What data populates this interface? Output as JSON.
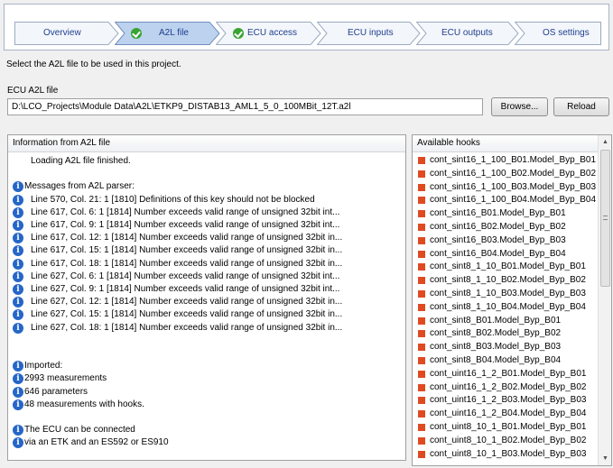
{
  "wizard": {
    "steps": [
      {
        "label": "Overview",
        "done": false,
        "active": false
      },
      {
        "label": "A2L file",
        "done": true,
        "active": true
      },
      {
        "label": "ECU access",
        "done": true,
        "active": false
      },
      {
        "label": "ECU inputs",
        "done": false,
        "active": false
      },
      {
        "label": "ECU outputs",
        "done": false,
        "active": false
      },
      {
        "label": "OS settings",
        "done": false,
        "active": false
      }
    ]
  },
  "hint": "Select the A2L file to be used  in this project.",
  "ecu_file": {
    "label": "ECU A2L file",
    "path": "D:\\LCO_Projects\\Module Data\\A2L\\ETKP9_DISTAB13_AML1_5_0_100MBit_12T.a2l",
    "browse_label": "Browse...",
    "reload_label": "Reload"
  },
  "info": {
    "header": "Information from A2L file",
    "lines": [
      {
        "text": "Loading A2L file finished.",
        "icon": false,
        "indent": true
      },
      {
        "text": "",
        "icon": false,
        "indent": false
      },
      {
        "text": "Messages from A2L parser:",
        "icon": true,
        "indent": false
      },
      {
        "text": "Line 570, Col. 21: 1 [1810] Definitions of this key should not be blocked",
        "icon": true,
        "indent": true
      },
      {
        "text": "Line 617, Col. 6: 1 [1814] Number exceeds valid range of unsigned 32bit int...",
        "icon": true,
        "indent": true
      },
      {
        "text": "Line 617, Col. 9: 1 [1814] Number exceeds valid range of unsigned 32bit int...",
        "icon": true,
        "indent": true
      },
      {
        "text": "Line 617, Col. 12: 1 [1814] Number exceeds valid range of unsigned 32bit in...",
        "icon": true,
        "indent": true
      },
      {
        "text": "Line 617, Col. 15: 1 [1814] Number exceeds valid range of unsigned 32bit in...",
        "icon": true,
        "indent": true
      },
      {
        "text": "Line 617, Col. 18: 1 [1814] Number exceeds valid range of unsigned 32bit in...",
        "icon": true,
        "indent": true
      },
      {
        "text": "Line 627, Col. 6: 1 [1814] Number exceeds valid range of unsigned 32bit int...",
        "icon": true,
        "indent": true
      },
      {
        "text": "Line 627, Col. 9: 1 [1814] Number exceeds valid range of unsigned 32bit int...",
        "icon": true,
        "indent": true
      },
      {
        "text": "Line 627, Col. 12: 1 [1814] Number exceeds valid range of unsigned 32bit in...",
        "icon": true,
        "indent": true
      },
      {
        "text": "Line 627, Col. 15: 1 [1814] Number exceeds valid range of unsigned 32bit in...",
        "icon": true,
        "indent": true
      },
      {
        "text": "Line 627, Col. 18: 1 [1814] Number exceeds valid range of unsigned 32bit in...",
        "icon": true,
        "indent": true
      },
      {
        "text": "",
        "icon": false,
        "indent": false
      },
      {
        "text": "",
        "icon": false,
        "indent": false
      },
      {
        "text": "Imported:",
        "icon": true,
        "indent": false
      },
      {
        "text": "2993 measurements",
        "icon": true,
        "indent": false
      },
      {
        "text": "646 parameters",
        "icon": true,
        "indent": false
      },
      {
        "text": "48 measurements with hooks.",
        "icon": true,
        "indent": false
      },
      {
        "text": "",
        "icon": false,
        "indent": false
      },
      {
        "text": "The ECU can be connected",
        "icon": true,
        "indent": false
      },
      {
        "text": "via an ETK and an ES592 or ES910",
        "icon": true,
        "indent": false
      }
    ]
  },
  "hooks": {
    "header": "Available hooks",
    "items": [
      "cont_sint16_1_100_B01.Model_Byp_B01",
      "cont_sint16_1_100_B02.Model_Byp_B02",
      "cont_sint16_1_100_B03.Model_Byp_B03",
      "cont_sint16_1_100_B04.Model_Byp_B04",
      "cont_sint16_B01.Model_Byp_B01",
      "cont_sint16_B02.Model_Byp_B02",
      "cont_sint16_B03.Model_Byp_B03",
      "cont_sint16_B04.Model_Byp_B04",
      "cont_sint8_1_10_B01.Model_Byp_B01",
      "cont_sint8_1_10_B02.Model_Byp_B02",
      "cont_sint8_1_10_B03.Model_Byp_B03",
      "cont_sint8_1_10_B04.Model_Byp_B04",
      "cont_sint8_B01.Model_Byp_B01",
      "cont_sint8_B02.Model_Byp_B02",
      "cont_sint8_B03.Model_Byp_B03",
      "cont_sint8_B04.Model_Byp_B04",
      "cont_uint16_1_2_B01.Model_Byp_B01",
      "cont_uint16_1_2_B02.Model_Byp_B02",
      "cont_uint16_1_2_B03.Model_Byp_B03",
      "cont_uint16_1_2_B04.Model_Byp_B04",
      "cont_uint8_10_1_B01.Model_Byp_B01",
      "cont_uint8_10_1_B02.Model_Byp_B02",
      "cont_uint8_10_1_B03.Model_Byp_B03"
    ]
  },
  "colors": {
    "step_active": "#bcd2ee",
    "step_inactive": "#f3f6fa",
    "check": "#39a432",
    "info_icon": "#2566c7",
    "hook_square": "#e04a22"
  }
}
